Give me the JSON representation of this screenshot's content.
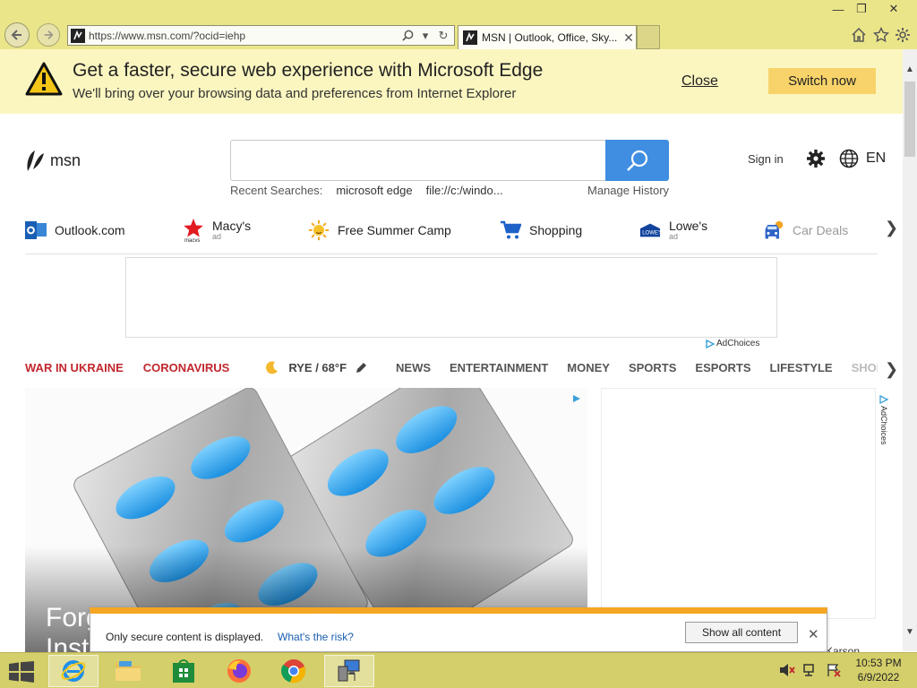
{
  "browser": {
    "url": "https://www.msn.com/?ocid=iehp",
    "tab_title": "MSN | Outlook, Office, Sky...",
    "tab_close": "✕",
    "window_controls": [
      "minimize",
      "restore",
      "close"
    ]
  },
  "edge_banner": {
    "title": "Get a faster, secure web experience with Microsoft Edge",
    "subtitle": "We'll bring over your browsing data and preferences from Internet Explorer",
    "close_label": "Close",
    "switch_label": "Switch now"
  },
  "msn": {
    "logo_text": "msn",
    "search_placeholder": "",
    "recent_label": "Recent Searches:",
    "recent_items": [
      "microsoft edge",
      "file://c:/windo..."
    ],
    "manage_history": "Manage History",
    "sign_in": "Sign in",
    "language": "EN"
  },
  "quicklinks": [
    {
      "label": "Outlook.com",
      "icon": "outlook-icon",
      "ad": ""
    },
    {
      "label": "Macy's",
      "icon": "macys-star-icon",
      "ad": "ad"
    },
    {
      "label": "Free Summer Camp",
      "icon": "sun-icon",
      "ad": ""
    },
    {
      "label": "Shopping",
      "icon": "cart-icon",
      "ad": ""
    },
    {
      "label": "Lowe's",
      "icon": "lowes-icon",
      "ad": "ad"
    },
    {
      "label": "Car Deals",
      "icon": "car-icon",
      "ad": ""
    }
  ],
  "ad": {
    "adchoices": "AdChoices"
  },
  "nav": {
    "highlight": [
      "WAR IN UKRAINE",
      "CORONAVIRUS"
    ],
    "weather": "RYE / 68°F",
    "categories": [
      "NEWS",
      "ENTERTAINMENT",
      "MONEY",
      "SPORTS",
      "ESPORTS",
      "LIFESTYLE"
    ],
    "faded": "SHOPPI"
  },
  "hero": {
    "title_line1": "Forg",
    "title_line2": "Inste"
  },
  "side": {
    "adchoices": "AdChoices",
    "partial": "Karson"
  },
  "security": {
    "message": "Only secure content is displayed.",
    "risk_link": "What's the risk?",
    "show_all": "Show all content",
    "close": "✕"
  },
  "taskbar": {
    "apps": [
      "internet-explorer",
      "file-explorer",
      "store",
      "firefox",
      "chrome",
      "network-app"
    ],
    "time": "10:53 PM",
    "date": "6/9/2022"
  },
  "colors": {
    "chrome_bg": "#ebe58a",
    "banner_bg": "#fbf6c0",
    "switch_btn": "#f7d36a",
    "search_btn": "#3f8ee2",
    "highlight_red": "#c1272d",
    "taskbar": "#d4cf6a"
  }
}
